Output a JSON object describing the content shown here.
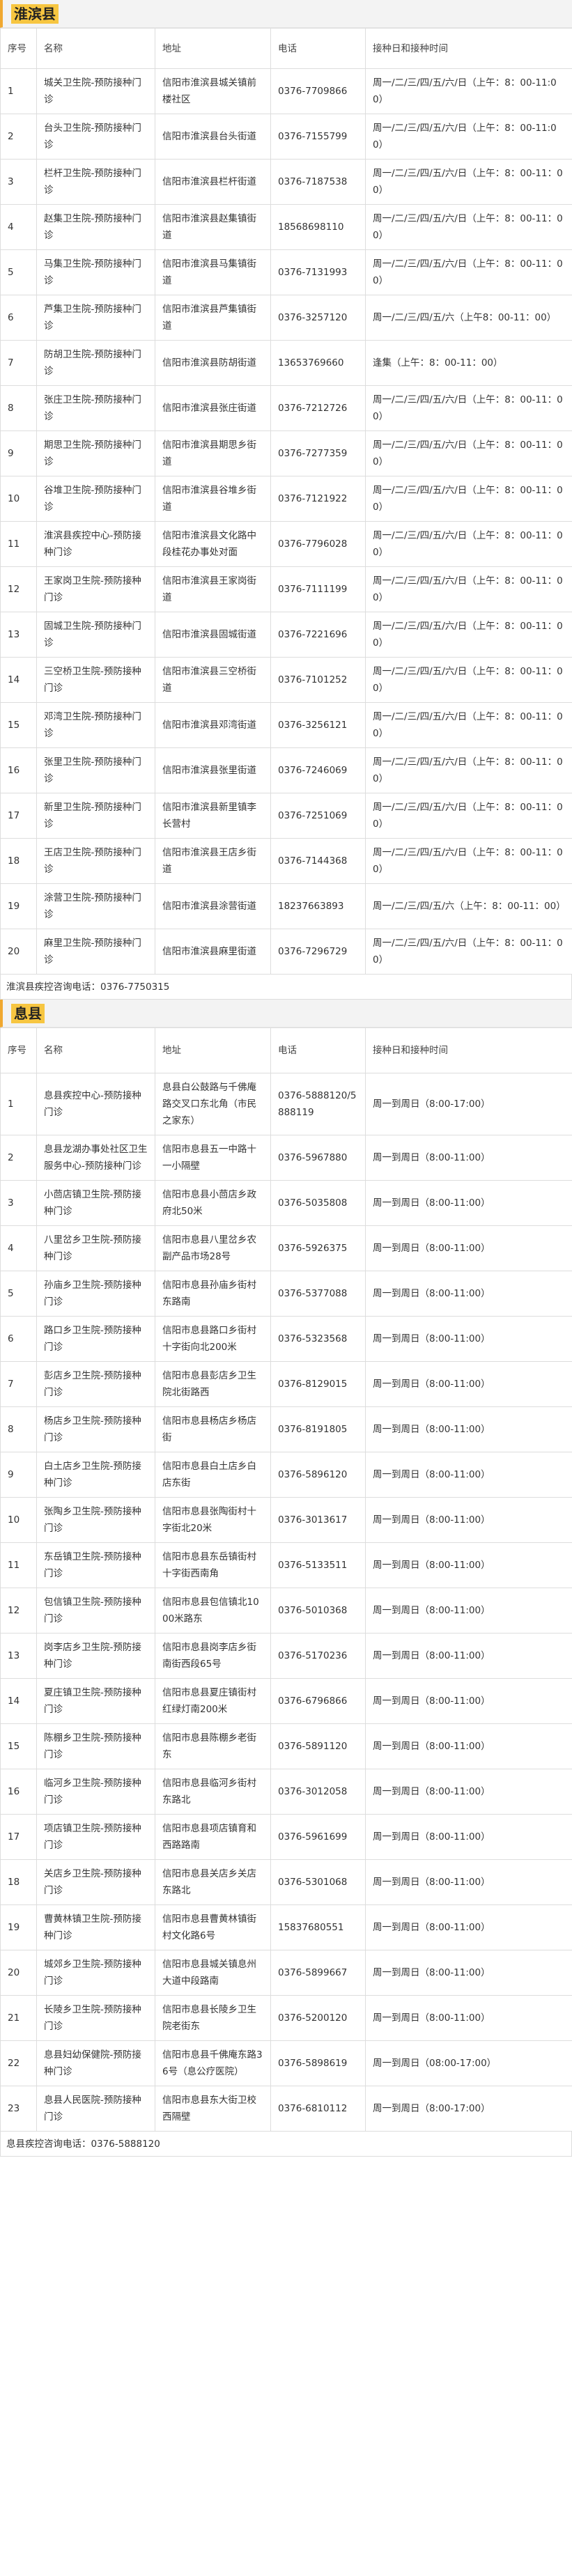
{
  "sections": [
    {
      "title": "淮滨县",
      "headers": [
        "序号",
        "名称",
        "地址",
        "电话",
        "接种日和接种时间"
      ],
      "rows": [
        [
          "1",
          "城关卫生院-预防接种门诊",
          "信阳市淮滨县城关镇前楼社区",
          "0376-7709866",
          "周一/二/三/四/五/六/日（上午：8：00-11:00）"
        ],
        [
          "2",
          "台头卫生院-预防接种门诊",
          "信阳市淮滨县台头街道",
          "0376-7155799",
          "周一/二/三/四/五/六/日（上午：8：00-11:00）"
        ],
        [
          "3",
          "栏杆卫生院-预防接种门诊",
          "信阳市淮滨县栏杆街道",
          "0376-7187538",
          "周一/二/三/四/五/六/日（上午：8：00-11：00）"
        ],
        [
          "4",
          "赵集卫生院-预防接种门诊",
          "信阳市淮滨县赵集镇街道",
          "18568698110",
          "周一/二/三/四/五/六/日（上午：8：00-11：00）"
        ],
        [
          "5",
          "马集卫生院-预防接种门诊",
          "信阳市淮滨县马集镇街道",
          "0376-7131993",
          "周一/二/三/四/五/六/日（上午：8：00-11：00）"
        ],
        [
          "6",
          "芦集卫生院-预防接种门诊",
          "信阳市淮滨县芦集镇街道",
          "0376-3257120",
          "周一/二/三/四/五/六（上午8：00-11：00）"
        ],
        [
          "7",
          "防胡卫生院-预防接种门诊",
          "信阳市淮滨县防胡街道",
          "13653769660",
          "逢集（上午：8：00-11：00）"
        ],
        [
          "8",
          "张庄卫生院-预防接种门诊",
          "信阳市淮滨县张庄街道",
          "0376-7212726",
          "周一/二/三/四/五/六/日（上午：8：00-11：00）"
        ],
        [
          "9",
          "期思卫生院-预防接种门诊",
          "信阳市淮滨县期思乡街道",
          "0376-7277359",
          "周一/二/三/四/五/六/日（上午：8：00-11：00）"
        ],
        [
          "10",
          "谷堆卫生院-预防接种门诊",
          "信阳市淮滨县谷堆乡街道",
          "0376-7121922",
          "周一/二/三/四/五/六/日（上午：8：00-11：00）"
        ],
        [
          "11",
          "淮滨县疾控中心-预防接种门诊",
          "信阳市淮滨县文化路中段桂花办事处对面",
          "0376-7796028",
          "周一/二/三/四/五/六/日（上午：8：00-11：00）"
        ],
        [
          "12",
          "王家岗卫生院-预防接种门诊",
          "信阳市淮滨县王家岗街道",
          "0376-7111199",
          "周一/二/三/四/五/六/日（上午：8：00-11：00）"
        ],
        [
          "13",
          "固城卫生院-预防接种门诊",
          "信阳市淮滨县固城街道",
          "0376-7221696",
          "周一/二/三/四/五/六/日（上午：8：00-11：00）"
        ],
        [
          "14",
          "三空桥卫生院-预防接种门诊",
          "信阳市淮滨县三空桥街道",
          "0376-7101252",
          "周一/二/三/四/五/六/日（上午：8：00-11：00）"
        ],
        [
          "15",
          "邓湾卫生院-预防接种门诊",
          "信阳市淮滨县邓湾街道",
          "0376-3256121",
          "周一/二/三/四/五/六/日（上午：8：00-11：00）"
        ],
        [
          "16",
          "张里卫生院-预防接种门诊",
          "信阳市淮滨县张里街道",
          "0376-7246069",
          "周一/二/三/四/五/六/日（上午：8：00-11：00）"
        ],
        [
          "17",
          "新里卫生院-预防接种门诊",
          "信阳市淮滨县新里镇李长营村",
          "0376-7251069",
          "周一/二/三/四/五/六/日（上午：8：00-11：00）"
        ],
        [
          "18",
          "王店卫生院-预防接种门诊",
          "信阳市淮滨县王店乡街道",
          "0376-7144368",
          "周一/二/三/四/五/六/日（上午：8：00-11：00）"
        ],
        [
          "19",
          "涂营卫生院-预防接种门诊",
          "信阳市淮滨县涂营街道",
          "18237663893",
          "周一/二/三/四/五/六（上午：8：00-11：00）"
        ],
        [
          "20",
          "麻里卫生院-预防接种门诊",
          "信阳市淮滨县麻里街道",
          "0376-7296729",
          "周一/二/三/四/五/六/日（上午：8：00-11：00）"
        ]
      ],
      "note": "淮滨县疾控咨询电话：0376-7750315"
    },
    {
      "title": "息县",
      "headers": [
        "序号",
        "名称",
        "地址",
        "电话",
        "接种日和接种时间"
      ],
      "rows": [
        [
          "1",
          "息县疾控中心-预防接种门诊",
          "息县白公鼓路与千佛庵路交叉口东北角（市民之家东）",
          "0376-5888120/5888119",
          "周一到周日（8:00-17:00）"
        ],
        [
          "2",
          "息县龙湖办事处社区卫生服务中心-预防接种门诊",
          "信阳市息县五一中路十一小隔壁",
          "0376-5967880",
          "周一到周日（8:00-11:00）"
        ],
        [
          "3",
          "小茴店镇卫生院-预防接种门诊",
          "信阳市息县小茴店乡政府北50米",
          "0376-5035808",
          "周一到周日（8:00-11:00）"
        ],
        [
          "4",
          "八里岔乡卫生院-预防接种门诊",
          "信阳市息县八里岔乡农副产品市场28号",
          "0376-5926375",
          "周一到周日（8:00-11:00）"
        ],
        [
          "5",
          "孙庙乡卫生院-预防接种门诊",
          "信阳市息县孙庙乡街村东路南",
          "0376-5377088",
          "周一到周日（8:00-11:00）"
        ],
        [
          "6",
          "路口乡卫生院-预防接种门诊",
          "信阳市息县路口乡街村十字街向北200米",
          "0376-5323568",
          "周一到周日（8:00-11:00）"
        ],
        [
          "7",
          "彭店乡卫生院-预防接种门诊",
          "信阳市息县彭店乡卫生院北街路西",
          "0376-8129015",
          "周一到周日（8:00-11:00）"
        ],
        [
          "8",
          "杨店乡卫生院-预防接种门诊",
          "信阳市息县杨店乡杨店街",
          "0376-8191805",
          "周一到周日（8:00-11:00）"
        ],
        [
          "9",
          "白土店乡卫生院-预防接种门诊",
          "信阳市息县白土店乡白店东街",
          "0376-5896120",
          "周一到周日（8:00-11:00）"
        ],
        [
          "10",
          "张陶乡卫生院-预防接种门诊",
          "信阳市息县张陶街村十字街北20米",
          "0376-3013617",
          "周一到周日（8:00-11:00）"
        ],
        [
          "11",
          "东岳镇卫生院-预防接种门诊",
          "信阳市息县东岳镇街村十字街西南角",
          "0376-5133511",
          "周一到周日（8:00-11:00）"
        ],
        [
          "12",
          "包信镇卫生院-预防接种门诊",
          "信阳市息县包信镇北1000米路东",
          "0376-5010368",
          "周一到周日（8:00-11:00）"
        ],
        [
          "13",
          "岗李店乡卫生院-预防接种门诊",
          "信阳市息县岗李店乡街南街西段65号",
          "0376-5170236",
          "周一到周日（8:00-11:00）"
        ],
        [
          "14",
          "夏庄镇卫生院-预防接种门诊",
          "信阳市息县夏庄镇街村红绿灯南200米",
          "0376-6796866",
          "周一到周日（8:00-11:00）"
        ],
        [
          "15",
          "陈棚乡卫生院-预防接种门诊",
          "信阳市息县陈棚乡老街东",
          "0376-5891120",
          "周一到周日（8:00-11:00）"
        ],
        [
          "16",
          "临河乡卫生院-预防接种门诊",
          "信阳市息县临河乡街村东路北",
          "0376-3012058",
          "周一到周日（8:00-11:00）"
        ],
        [
          "17",
          "项店镇卫生院-预防接种门诊",
          "信阳市息县项店镇育和西路路南",
          "0376-5961699",
          "周一到周日（8:00-11:00）"
        ],
        [
          "18",
          "关店乡卫生院-预防接种门诊",
          "信阳市息县关店乡关店东路北",
          "0376-5301068",
          "周一到周日（8:00-11:00）"
        ],
        [
          "19",
          "曹黄林镇卫生院-预防接种门诊",
          "信阳市息县曹黄林镇街村文化路6号",
          "15837680551",
          "周一到周日（8:00-11:00）"
        ],
        [
          "20",
          "城郊乡卫生院-预防接种门诊",
          "信阳市息县城关镇息州大道中段路南",
          "0376-5899667",
          "周一到周日（8:00-11:00）"
        ],
        [
          "21",
          "长陵乡卫生院-预防接种门诊",
          "信阳市息县长陵乡卫生院老街东",
          "0376-5200120",
          "周一到周日（8:00-11:00）"
        ],
        [
          "22",
          "息县妇幼保健院-预防接种门诊",
          "信阳市息县千佛庵东路36号（息公疗医院）",
          "0376-5898619",
          "周一到周日（08:00-17:00）"
        ],
        [
          "23",
          "息县人民医院-预防接种门诊",
          "信阳市息县东大街卫校西隔壁",
          "0376-6810112",
          "周一到周日（8:00-17:00）"
        ]
      ],
      "note": "息县疾控咨询电话：0376-5888120"
    }
  ]
}
